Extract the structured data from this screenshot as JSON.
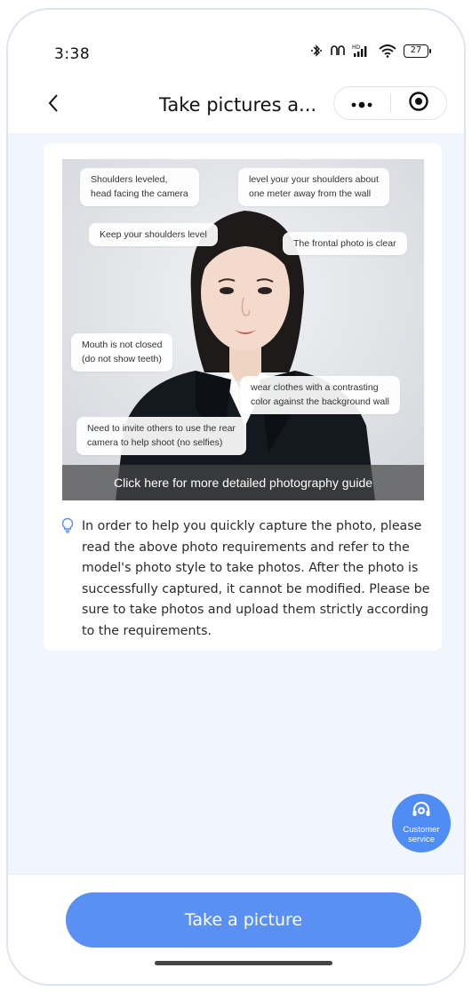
{
  "status_bar": {
    "time": "3:38",
    "battery": "27",
    "icons": [
      "bluetooth-icon",
      "vibrate-icon",
      "hd-signal-icon",
      "wifi-icon",
      "battery-icon"
    ]
  },
  "nav": {
    "title": "Take pictures a...",
    "icons": [
      "back-chevron-icon",
      "more-dots-icon",
      "target-icon"
    ]
  },
  "guide": {
    "tags": [
      "Shoulders leveled,\nhead facing the camera",
      "level your your shoulders about\none meter away from the wall",
      "Keep your shoulders level",
      "The frontal photo is clear",
      "Mouth is not closed\n(do not show teeth)",
      "wear clothes with a contrasting\ncolor against the background wall",
      "Need to invite others to use the rear\ncamera to help shoot (no selfies)"
    ],
    "link_text": "Click here for more detailed photography guide"
  },
  "notice": {
    "icon": "lightbulb-icon",
    "text": "In order to help you quickly capture the photo, please read the above photo requirements and refer to the model's photo style to take photos. After the photo is successfully captured, it cannot be modified. Please be sure to take photos and upload them strictly according to the requirements."
  },
  "customer_service": {
    "icon": "headset-icon",
    "label": "Customer service"
  },
  "bottom": {
    "take_picture_label": "Take a picture"
  },
  "colors": {
    "accent": "#5a90f2",
    "cs_button": "#4f8cf4",
    "page_bg": "#f1f5fd",
    "notice_icon": "#4f8cf4"
  }
}
